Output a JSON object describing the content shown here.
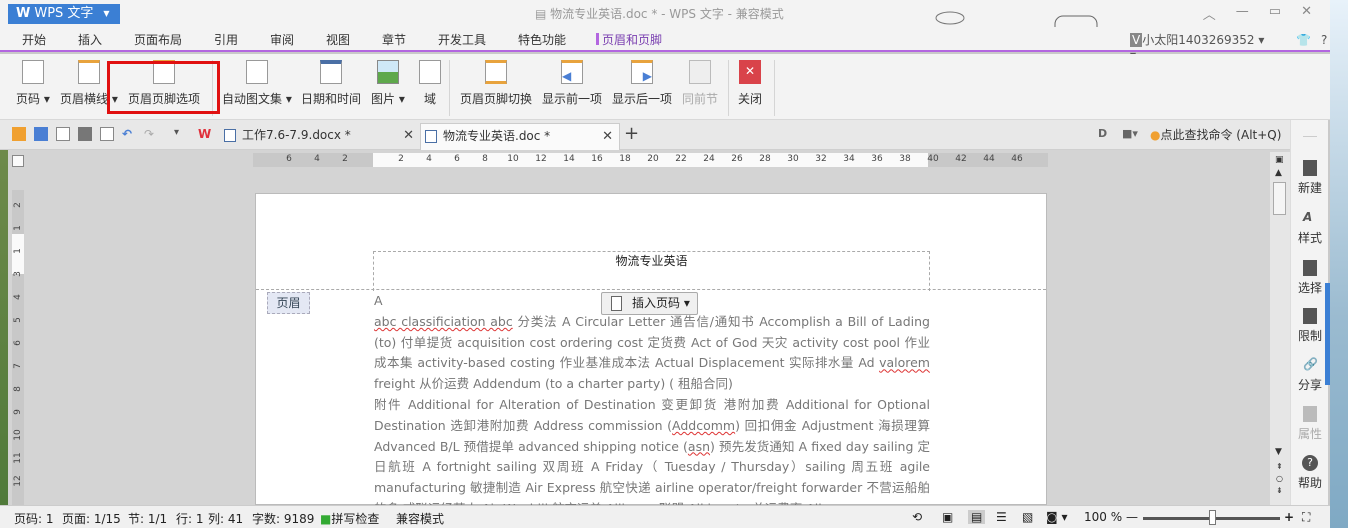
{
  "app": {
    "name": "WPS 文字",
    "window_title": "物流专业英语.doc * - WPS 文字 - 兼容模式"
  },
  "menu": {
    "tabs": [
      "开始",
      "插入",
      "页面布局",
      "引用",
      "审阅",
      "视图",
      "章节",
      "开发工具",
      "特色功能",
      "页眉和页脚"
    ],
    "active": "页眉和页脚",
    "user": "小太阳1403269352",
    "help": "?"
  },
  "ribbon": {
    "buttons": [
      {
        "label": "页码",
        "icon": "page-number-icon",
        "dropdown": true
      },
      {
        "label": "页眉横线",
        "icon": "header-line-icon",
        "dropdown": true
      },
      {
        "label": "页眉页脚选项",
        "icon": "header-footer-options-icon",
        "dropdown": false,
        "highlighted": true
      },
      {
        "label": "自动图文集",
        "icon": "autotext-icon",
        "dropdown": true
      },
      {
        "label": "日期和时间",
        "icon": "calendar-icon",
        "dropdown": false
      },
      {
        "label": "图片",
        "icon": "picture-icon",
        "dropdown": true
      },
      {
        "label": "域",
        "icon": "field-icon",
        "dropdown": false
      },
      {
        "label": "页眉页脚切换",
        "icon": "switch-header-footer-icon",
        "dropdown": false
      },
      {
        "label": "显示前一项",
        "icon": "show-previous-icon",
        "dropdown": false
      },
      {
        "label": "显示后一项",
        "icon": "show-next-icon",
        "dropdown": false
      },
      {
        "label": "同前节",
        "icon": "same-as-previous-icon",
        "dropdown": false,
        "disabled": true
      },
      {
        "label": "关闭",
        "icon": "close-red-icon",
        "dropdown": false
      }
    ]
  },
  "tabs": {
    "documents": [
      {
        "name": "工作7.6-7.9.docx *",
        "active": false
      },
      {
        "name": "物流专业英语.doc *",
        "active": true
      }
    ],
    "new_tab": "+",
    "finder": "点此查找命令 (Alt+Q)"
  },
  "ruler": {
    "h_ticks": [
      "6",
      "4",
      "2",
      "2",
      "4",
      "6",
      "8",
      "10",
      "12",
      "14",
      "16",
      "18",
      "20",
      "22",
      "24",
      "26",
      "28",
      "30",
      "32",
      "34",
      "36",
      "38",
      "40",
      "42",
      "44",
      "46"
    ],
    "v_ticks": [
      "2",
      "1",
      "1",
      "3",
      "4",
      "5",
      "6",
      "7",
      "8",
      "9",
      "10",
      "11",
      "12"
    ]
  },
  "document": {
    "header_text": "物流专业英语",
    "header_label": "页眉",
    "insert_page_number": "插入页码",
    "paragraphs": [
      "A",
      "abc classificiation abc 分类法 A Circular Letter 通告信/通知书 Accomplish a Bill of Lading (to) 付单提货 acquisition cost ordering cost 定货费 Act of God 天灾 activity cost pool 作业成本集 activity-based costing 作业基准成本法 Actual Displacement 实际排水量 Ad valorem freight 从价运费 Addendum (to a charter party) ( 租船合同)",
      "附件 Additional for Alteration of Destination 变更卸货 港附加费 Additional for Optional Destination 选卸港附加费 Address commission (Addcomm) 回扣佣金 Adjustment 海损理算 Advanced B/L 预借提单 advanced shipping notice (asn) 预先发货通知 A fixed day sailing 定日航班 A fortnight sailing 双周班 A Friday（ Tuesday / Thursday）sailing 周五班 agile manufacturing 敏捷制造 Air Express 航空快递 airline operator/freight forwarder 不营运船舶的多 式联运经营人 Air Waybill 航空运单 Alliance 联盟 All in rate 总运费率 All"
    ]
  },
  "sidepanel": {
    "items": [
      {
        "label": "新建",
        "icon": "new-doc-icon"
      },
      {
        "label": "样式",
        "icon": "style-icon"
      },
      {
        "label": "选择",
        "icon": "select-icon"
      },
      {
        "label": "限制",
        "icon": "restrict-icon"
      },
      {
        "label": "分享",
        "icon": "share-link-icon"
      },
      {
        "label": "属性",
        "icon": "properties-icon",
        "disabled": true
      },
      {
        "label": "帮助",
        "icon": "help-icon"
      }
    ]
  },
  "status": {
    "page_code": "页码: 1",
    "page": "页面: 1/15",
    "section": "节: 1/1",
    "row": "行: 1",
    "col": "列: 41",
    "word_count": "字数: 9189",
    "spell_check": "拼写检查",
    "compat_mode": "兼容模式",
    "zoom": "100 %",
    "zoom_fraction": 0.5
  }
}
